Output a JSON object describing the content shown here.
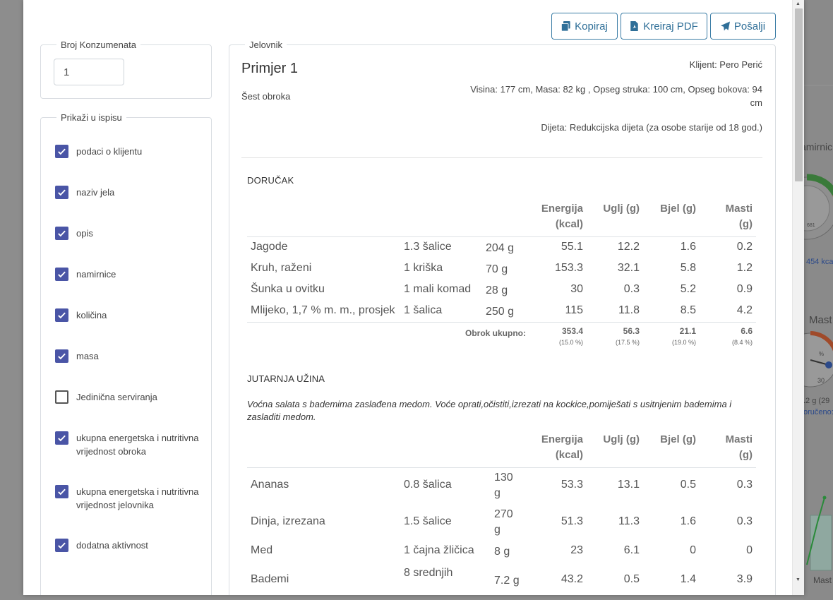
{
  "background": {
    "texts": [
      "amirnic",
      "454 kca",
      "Mast",
      ".2 g (29",
      "oručeno:",
      "30",
      "681",
      "%",
      "Mast"
    ]
  },
  "toolbar": {
    "copy_label": "Kopiraj",
    "pdf_label": "Kreiraj PDF",
    "send_label": "Pošalji"
  },
  "consumers": {
    "legend": "Broj Konzumenata",
    "value": "1"
  },
  "print_options": {
    "legend": "Prikaži u ispisu",
    "items": [
      {
        "label": "podaci o klijentu",
        "checked": true
      },
      {
        "label": "naziv jela",
        "checked": true
      },
      {
        "label": "opis",
        "checked": true
      },
      {
        "label": "namirnice",
        "checked": true
      },
      {
        "label": "količina",
        "checked": true
      },
      {
        "label": "masa",
        "checked": true
      },
      {
        "label": "Jedinična serviranja",
        "checked": false
      },
      {
        "label": "ukupna energetska i nutritivna vrijednost obroka",
        "checked": true
      },
      {
        "label": "ukupna energetska i nutritivna vrijednost jelovnika",
        "checked": true
      },
      {
        "label": "dodatna aktivnost",
        "checked": true
      }
    ]
  },
  "menu": {
    "legend": "Jelovnik",
    "title": "Primjer 1",
    "subtitle": "Šest obroka",
    "client": "Klijent: Pero Perić",
    "measures": "Visina: 177 cm, Masa: 82 kg , Opseg struka: 100 cm, Opseg bokova: 94 cm",
    "diet": "Dijeta: Redukcijska dijeta (za osobe starije od 18 god.)",
    "col_energy": "Energija (kcal)",
    "col_carb": "Uglj (g)",
    "col_protein": "Bjel (g)",
    "col_fat": "Masti (g)",
    "meals": [
      {
        "name": "DORUČAK",
        "items": [
          {
            "food": "Jagode",
            "qty": "1.3 šalice",
            "mass": "204 g",
            "energy": "55.1",
            "carb": "12.2",
            "protein": "1.6",
            "fat": "0.2"
          },
          {
            "food": "Kruh, raženi",
            "qty": "1 kriška",
            "mass": "70 g",
            "energy": "153.3",
            "carb": "32.1",
            "protein": "5.8",
            "fat": "1.2"
          },
          {
            "food": "Šunka u ovitku",
            "qty": "1 mali komad",
            "mass": "28 g",
            "energy": "30",
            "carb": "0.3",
            "protein": "5.2",
            "fat": "0.9"
          },
          {
            "food": "Mlijeko, 1,7 % m. m., prosjek",
            "qty": "1 šalica",
            "mass": "250 g",
            "energy": "115",
            "carb": "11.8",
            "protein": "8.5",
            "fat": "4.2"
          }
        ],
        "total_label": "Obrok ukupno:",
        "total": {
          "energy": "353.4",
          "carb": "56.3",
          "protein": "21.1",
          "fat": "6.6"
        },
        "total_pct": {
          "energy": "(15.0 %)",
          "carb": "(17.5 %)",
          "protein": "(19.0 %)",
          "fat": "(8.4 %)"
        }
      },
      {
        "name": "JUTARNJA UŽINA",
        "description": "Voćna salata s bademima zaslađena medom. Voće oprati,očistiti,izrezati na kockice,pomiješati s usitnjenim bademima i zasladiti medom.",
        "items": [
          {
            "food": "Ananas",
            "qty": "0.8 šalica",
            "mass": "130 g",
            "energy": "53.3",
            "carb": "13.1",
            "protein": "0.5",
            "fat": "0.3"
          },
          {
            "food": "Dinja, izrezana",
            "qty": "1.5 šalice",
            "mass": "270 g",
            "energy": "51.3",
            "carb": "11.3",
            "protein": "1.6",
            "fat": "0.3"
          },
          {
            "food": "Med",
            "qty": "1 čajna žličica",
            "mass": "8 g",
            "energy": "23",
            "carb": "6.1",
            "protein": "0",
            "fat": "0"
          },
          {
            "food": "Bademi",
            "qty": "8 srednjih",
            "mass": "7.2 g",
            "energy": "43.2",
            "carb": "0.5",
            "protein": "1.4",
            "fat": "3.9"
          }
        ]
      }
    ]
  },
  "colors": {
    "accent": "#2f6f98",
    "checkbox": "#4a55a6"
  }
}
